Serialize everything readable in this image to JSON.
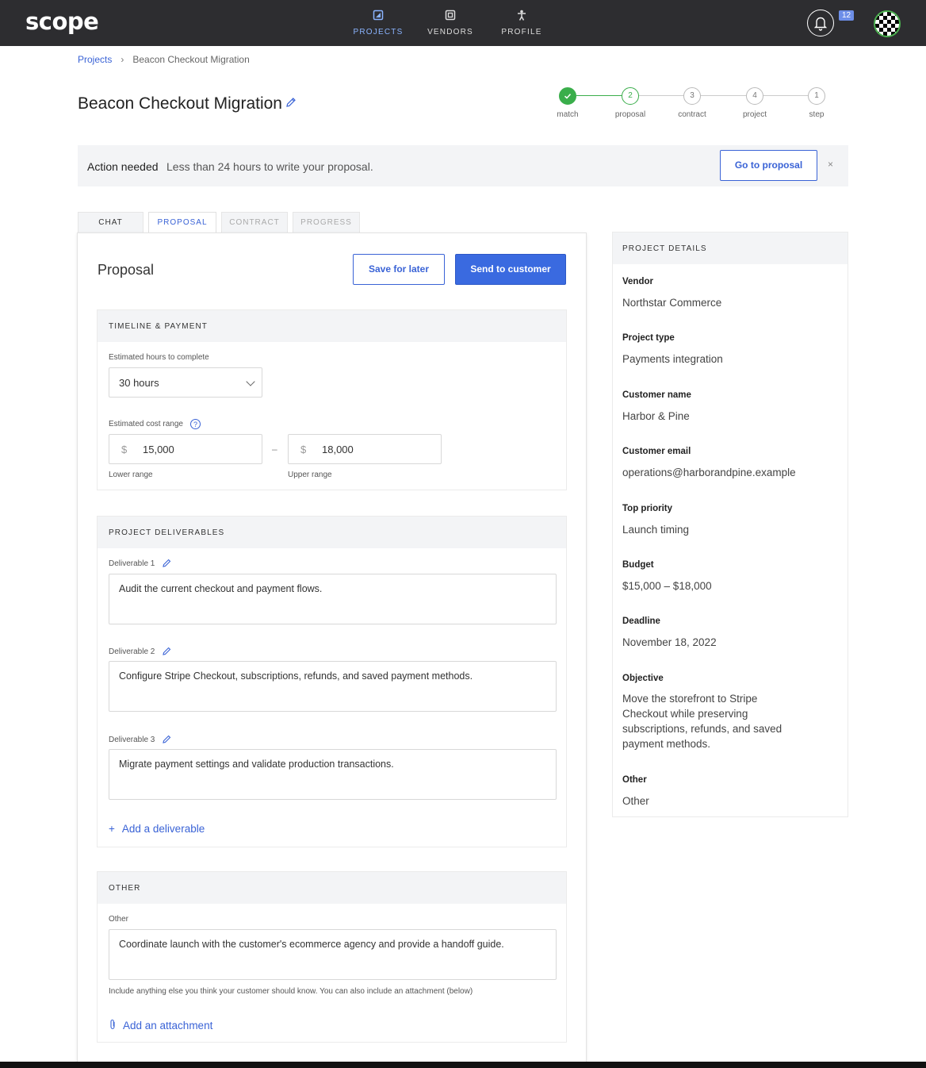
{
  "app": {
    "logo": "scope"
  },
  "nav": {
    "items": [
      {
        "label": "PROJECTS",
        "icon": "projects-icon",
        "active": true
      },
      {
        "label": "VENDORS",
        "icon": "vendors-icon",
        "active": false
      },
      {
        "label": "PROFILE",
        "icon": "profile-icon",
        "active": false
      }
    ],
    "notification_count": "12"
  },
  "breadcrumb": {
    "root": "Projects",
    "current": "Beacon Checkout Migration"
  },
  "page": {
    "title": "Beacon Checkout Migration"
  },
  "stepper": {
    "steps": [
      {
        "number": "",
        "label": "match",
        "state": "done"
      },
      {
        "number": "2",
        "label": "proposal",
        "state": "current"
      },
      {
        "number": "3",
        "label": "contract",
        "state": "pending"
      },
      {
        "number": "4",
        "label": "project",
        "state": "pending"
      },
      {
        "number": "1",
        "label": "step",
        "state": "pending"
      }
    ]
  },
  "banner": {
    "title": "Action needed",
    "message": "Less than 24 hours to  write your proposal.",
    "button": "Go to proposal",
    "close": "×"
  },
  "tabs": [
    "CHAT",
    "PROPOSAL",
    "CONTRACT",
    "PROGRESS"
  ],
  "proposal": {
    "title": "Proposal",
    "save_label": "Save for later",
    "send_label": "Send to customer",
    "timeline": {
      "heading": "TIMELINE & PAYMENT",
      "hours_label": "Estimated hours to complete",
      "hours_value": "30 hours",
      "cost_label": "Estimated cost range",
      "help": "?",
      "currency": "$",
      "lower_value": "15,000",
      "upper_value": "18,000",
      "dash": "–",
      "lower_label": "Lower range",
      "upper_label": "Upper range"
    },
    "deliverables": {
      "heading": "PROJECT DELIVERABLES",
      "items": [
        {
          "label": "Deliverable 1",
          "text": "Audit the current checkout and payment flows."
        },
        {
          "label": "Deliverable 2",
          "text": "Configure Stripe Checkout, subscriptions, refunds, and saved payment methods."
        },
        {
          "label": "Deliverable 3",
          "text": "Migrate payment settings and validate production transactions."
        }
      ],
      "add_label": "Add a deliverable",
      "add_symbol": "+"
    },
    "other": {
      "heading": "OTHER",
      "label": "Other",
      "text": "Coordinate launch with the customer's ecommerce agency and provide a handoff guide.",
      "hint": "Include anything else you think your customer should know. You can also include an attachment (below)",
      "attach_label": "Add an attachment"
    }
  },
  "details": {
    "heading": "PROJECT DETAILS",
    "fields": [
      {
        "label": "Vendor",
        "value": "Northstar Commerce"
      },
      {
        "label": "Project type",
        "value": "Payments integration"
      },
      {
        "label": "Customer name",
        "value": "Harbor & Pine"
      },
      {
        "label": "Customer email",
        "value": "operations@harborandpine.example"
      },
      {
        "label": "Top priority",
        "value": "Launch timing"
      },
      {
        "label": "Budget",
        "value": "$15,000 – $18,000"
      },
      {
        "label": "Deadline",
        "value": "November 18, 2022"
      },
      {
        "label": "Objective",
        "value": "Move the storefront to Stripe Checkout while preserving subscriptions, refunds, and saved payment methods."
      },
      {
        "label": "Other",
        "value": "Other"
      }
    ]
  },
  "colors": {
    "accent": "#3a63d6",
    "primary_button": "#3a6ae0",
    "success": "#3aae4b",
    "topbar": "#2d2d30"
  }
}
